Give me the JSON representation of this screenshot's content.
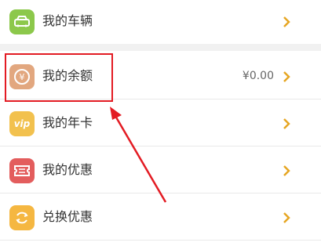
{
  "menu": {
    "items": [
      {
        "label": "我的车辆",
        "icon": "car-icon",
        "color": "#8cc84b"
      },
      {
        "label": "我的余额",
        "icon": "yen-coin-icon",
        "color": "#e2a77f",
        "value": "¥0.00"
      },
      {
        "label": "我的年卡",
        "icon": "vip-card-icon",
        "color": "#f2c14e",
        "icon_text": "vip"
      },
      {
        "label": "我的优惠",
        "icon": "coupon-icon",
        "color": "#e35d5d"
      },
      {
        "label": "兑换优惠",
        "icon": "exchange-icon",
        "color": "#f5b741"
      }
    ],
    "chevron_color": "#e6a623"
  },
  "annotation": {
    "highlight_color": "#e31b23"
  }
}
